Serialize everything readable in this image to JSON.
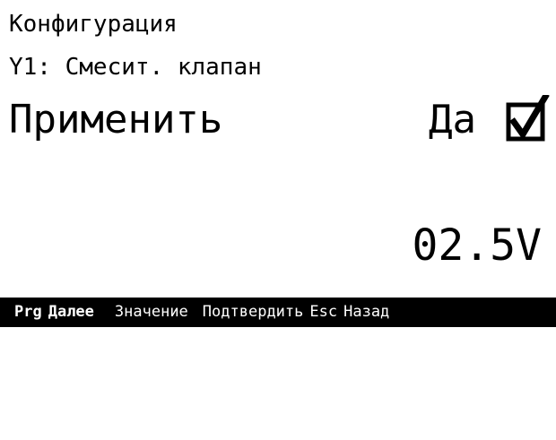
{
  "screen": {
    "title": "Конфигурация",
    "subtitle": "Y1: Смесит. клапан",
    "apply_label": "Применить",
    "apply_value": "Да",
    "apply_checked": true,
    "voltage": "02.5V"
  },
  "footer": {
    "prg_key": "Prg",
    "next_label": "Далее",
    "updown_icon": "up-down-arrows-icon",
    "value_label": "Значение",
    "enter_icon": "enter-return-icon",
    "confirm_label": "Подтвердить",
    "esc_key": "Esc",
    "back_label": "Назад"
  },
  "colors": {
    "background": "#ffffff",
    "text": "#000000",
    "footer_bg": "#000000",
    "footer_text": "#ffffff"
  }
}
